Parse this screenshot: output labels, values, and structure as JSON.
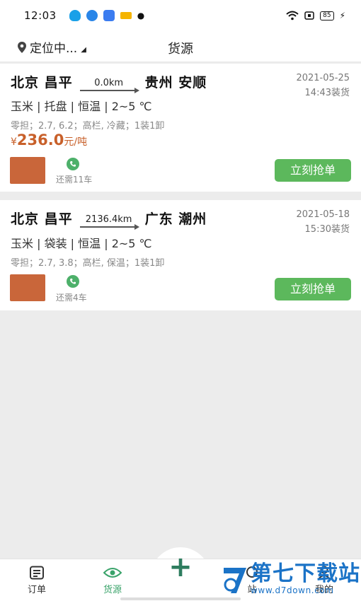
{
  "status_bar": {
    "time": "12:03",
    "battery": "85"
  },
  "header": {
    "location": "定位中...",
    "title": "货源"
  },
  "cards": [
    {
      "from": "北京 昌平",
      "distance": "0.0km",
      "to": "贵州 安顺",
      "date": "2021-05-25",
      "load_time": "14:43装货",
      "goods": "玉米 | 托盘 | 恒温 | 2~5 ℃",
      "specs": "零担；2.7, 6.2；高栏, 冷藏；1装1卸",
      "price_symbol": "¥",
      "price_value": "236.0",
      "price_unit": "元/吨",
      "need": "还需11车",
      "grab_label": "立刻抢单"
    },
    {
      "from": "北京 昌平",
      "distance": "2136.4km",
      "to": "广东 潮州",
      "date": "2021-05-18",
      "load_time": "15:30装货",
      "goods": "玉米 | 袋装 | 恒温 | 2~5 ℃",
      "specs": "零担；2.7, 3.8；高栏, 保温；1装1卸",
      "need": "还需4车",
      "grab_label": "立刻抢单"
    }
  ],
  "bottom_nav": {
    "orders": "订单",
    "cargo": "货源",
    "post": "站",
    "mine": "我的"
  },
  "watermark": {
    "text": "第七下载站",
    "url": "www.d7down.com"
  },
  "colors": {
    "accent_green": "#5cb85c",
    "price_orange": "#c8602a",
    "nav_active": "#3aa36a"
  }
}
